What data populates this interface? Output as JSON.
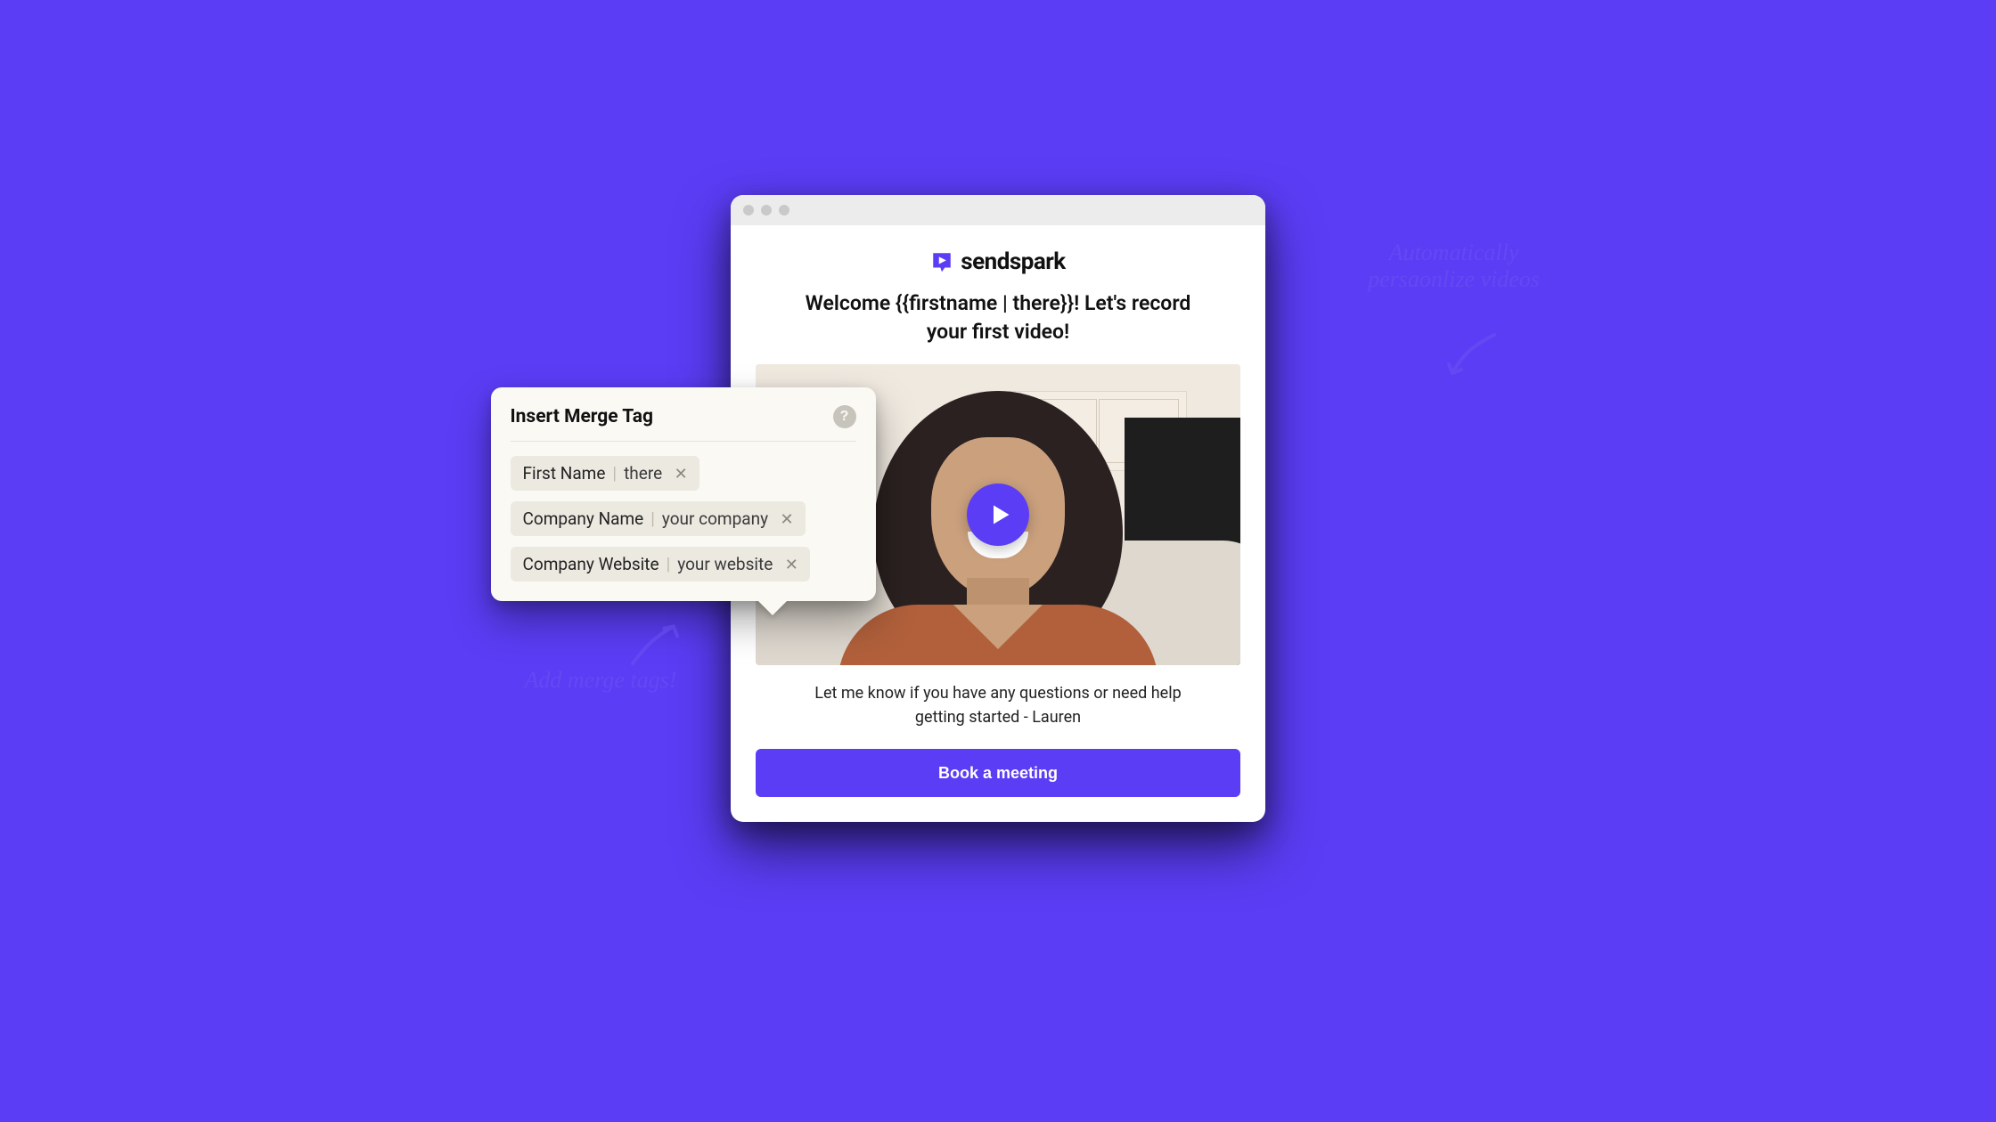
{
  "brand": {
    "name": "sendspark"
  },
  "page": {
    "headline": "Welcome {{firstname | there}}! Let's record your first video!",
    "caption": "Let me know if you have any questions or need help getting started - Lauren",
    "cta_label": "Book a meeting"
  },
  "merge_popover": {
    "title": "Insert Merge Tag",
    "tags": [
      {
        "name": "First Name",
        "fallback": "there"
      },
      {
        "name": "Company Name",
        "fallback": "your company"
      },
      {
        "name": "Company Website",
        "fallback": "your website"
      }
    ]
  },
  "annotations": {
    "right": "Automatically\npersaonlize videos",
    "left": "Add merge tags!"
  },
  "colors": {
    "accent": "#5b3df5"
  }
}
